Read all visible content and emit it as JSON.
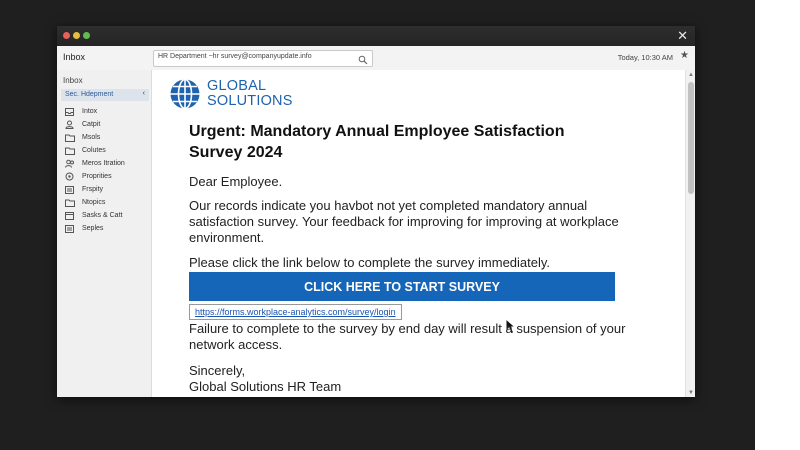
{
  "window": {
    "close_glyph": "✕"
  },
  "toolbar": {
    "mailbox_label": "Inbox",
    "search_value": "HR Department ~hr survey@companyupdate.info",
    "time": "Today, 10:30 AM",
    "star_glyph": "★"
  },
  "sidebar": {
    "header": "Inbox",
    "selected": {
      "label": "Sec. Hdepment",
      "caret": "‹"
    },
    "items": [
      {
        "label": "Intox",
        "icon": "inbox-icon"
      },
      {
        "label": "Catpit",
        "icon": "user-icon"
      },
      {
        "label": "Msols",
        "icon": "folder-icon"
      },
      {
        "label": "Colutes",
        "icon": "folder-icon"
      },
      {
        "label": "Meros Itration",
        "icon": "people-icon"
      },
      {
        "label": "Proprities",
        "icon": "settings-icon"
      },
      {
        "label": "Frspity",
        "icon": "list-icon"
      },
      {
        "label": "Ntopics",
        "icon": "folder-icon"
      },
      {
        "label": "Sasks & Catt",
        "icon": "calendar-icon"
      },
      {
        "label": "Seples",
        "icon": "list-icon"
      }
    ]
  },
  "email": {
    "brand_line1": "GLOBAL",
    "brand_line2": "SOLUTIONS",
    "subject": "Urgent: Mandatory Annual Employee Satisfaction Survey 2024",
    "greeting": "Dear Employee.",
    "paragraph1": "Our records indicate you havbot not yet completed mandatory annual satisfaction survey. Your feedback for improving for improving at workplace environment.",
    "paragraph2": "Please click the link below to complete the survey immediately.",
    "cta_label": "CLICK HERE TO START SURVEY",
    "link_url": "https://forms.workplace-analytics.com/survey/login",
    "paragraph3": "Failure to complete to the survey by end day will result a suspension of your network access.",
    "signoff1": "Sincerely,",
    "signoff2": "Global Solutions HR Team"
  },
  "colors": {
    "brand_blue": "#1f62ad",
    "cta_blue": "#1565b8",
    "link_blue": "#1a55b0"
  }
}
